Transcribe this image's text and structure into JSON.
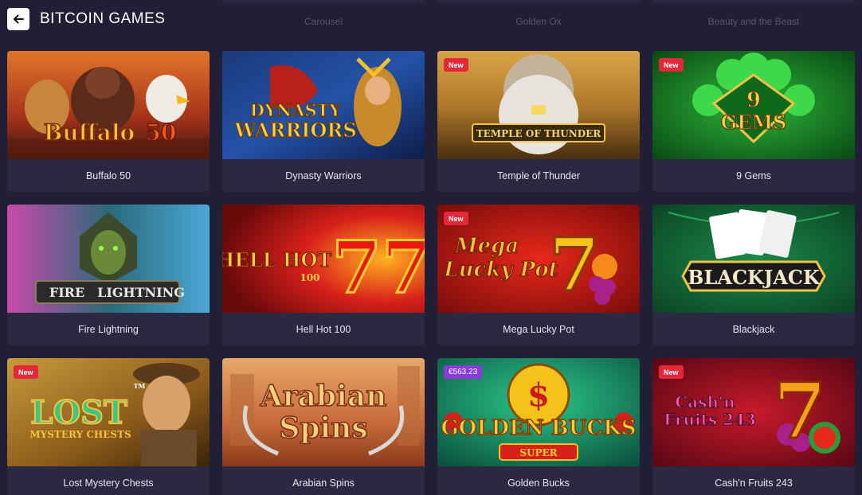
{
  "page": {
    "title": "BITCOIN GAMES"
  },
  "carousel_ghost": [
    "Carousel",
    "Golden Ox",
    "Beauty and the Beast"
  ],
  "games": [
    {
      "name": "Buffalo 50",
      "badge": "",
      "art_text": [
        "Buffalo",
        "50"
      ],
      "palette": "buffalo"
    },
    {
      "name": "Dynasty Warriors",
      "badge": "",
      "art_text": [
        "DYNASTY",
        "WARRIORS"
      ],
      "palette": "dynasty"
    },
    {
      "name": "Temple of Thunder",
      "badge": "New",
      "art_text": [
        "TEMPLE OF THUNDER"
      ],
      "palette": "temple"
    },
    {
      "name": "9 Gems",
      "badge": "New",
      "art_text": [
        "9",
        "GEMS"
      ],
      "palette": "gems"
    },
    {
      "name": "Fire Lightning",
      "badge": "",
      "art_text": [
        "FIRE",
        "LIGHTNING"
      ],
      "palette": "fire"
    },
    {
      "name": "Hell Hot 100",
      "badge": "",
      "art_text": [
        "HELL HOT",
        "100",
        "77"
      ],
      "palette": "hellhot"
    },
    {
      "name": "Mega Lucky Pot",
      "badge": "New",
      "art_text": [
        "Mega",
        "Lucky Pot",
        "7"
      ],
      "palette": "mega"
    },
    {
      "name": "Blackjack",
      "badge": "",
      "art_text": [
        "BLACKJACK"
      ],
      "palette": "blackjack"
    },
    {
      "name": "Lost Mystery Chests",
      "badge": "New",
      "art_text": [
        "LOST",
        "MYSTERY CHESTS",
        "TM"
      ],
      "palette": "lost"
    },
    {
      "name": "Arabian Spins",
      "badge": "",
      "art_text": [
        "Arabian",
        "Spins"
      ],
      "palette": "arabian"
    },
    {
      "name": "Golden Bucks",
      "badge": "€563.23",
      "badge_type": "jackpot",
      "art_text": [
        "$",
        "GOLDEN BUCKS",
        "SUPER"
      ],
      "palette": "golden"
    },
    {
      "name": "Cash'n Fruits 243",
      "badge": "New",
      "art_text": [
        "Cash'n",
        "Fruits 243",
        "7"
      ],
      "palette": "cash"
    }
  ],
  "icons": {
    "back": "arrow-left-icon"
  }
}
